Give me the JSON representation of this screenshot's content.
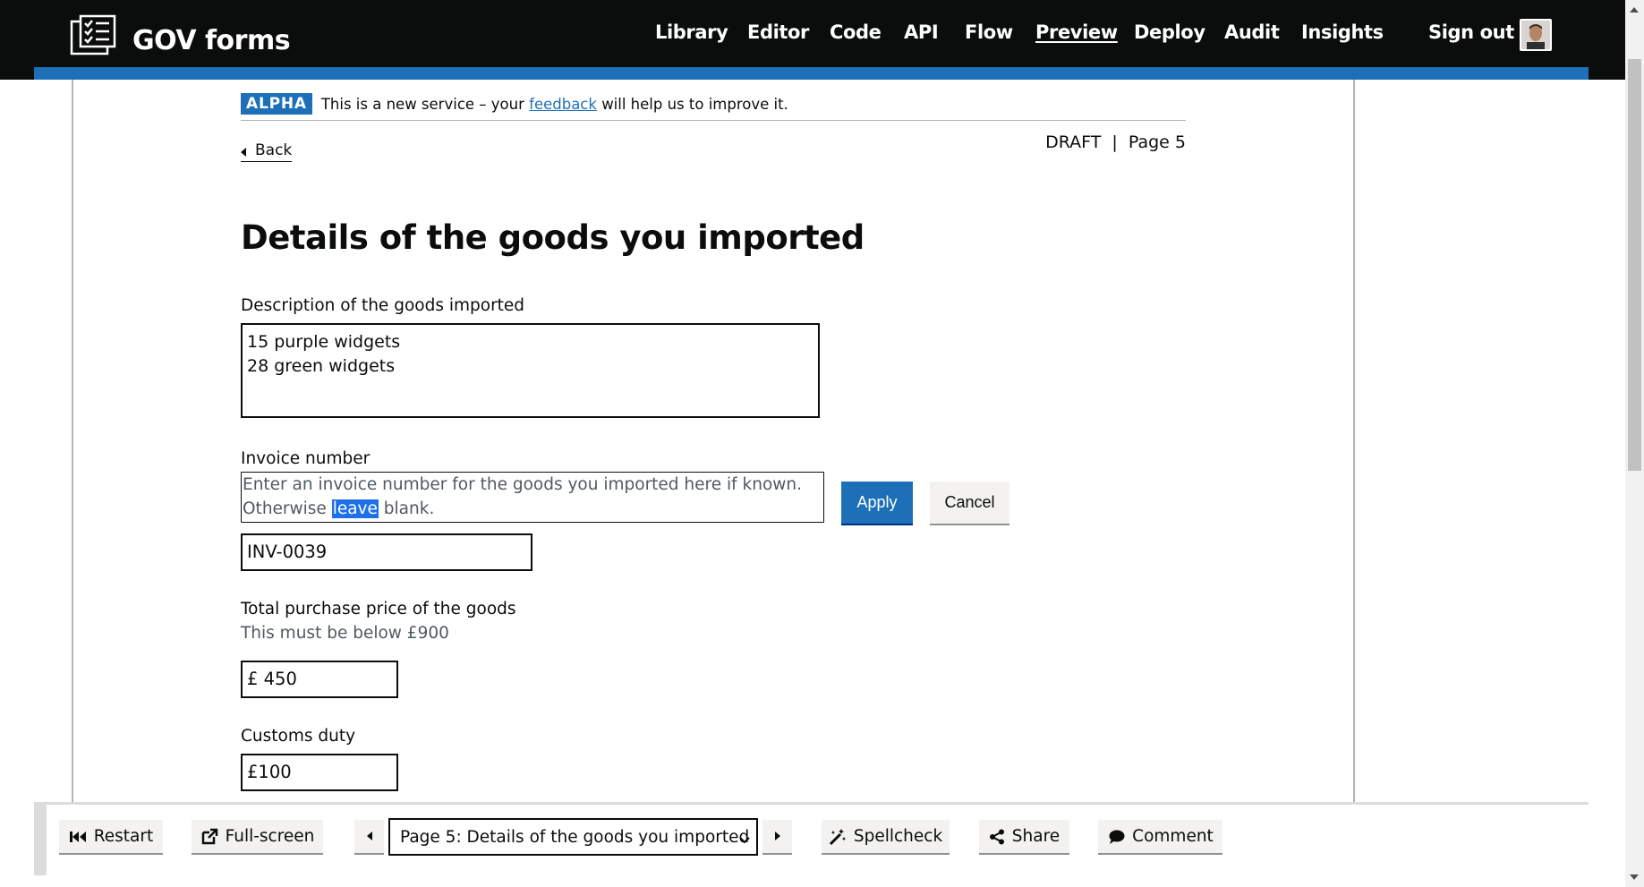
{
  "header": {
    "brand": "GOV forms",
    "nav": [
      {
        "label": "Library",
        "active": false
      },
      {
        "label": "Editor",
        "active": false
      },
      {
        "label": "Code",
        "active": false
      },
      {
        "label": "API",
        "active": false
      },
      {
        "label": "Flow",
        "active": false
      },
      {
        "label": "Preview",
        "active": true
      },
      {
        "label": "Deploy",
        "active": false
      },
      {
        "label": "Audit",
        "active": false
      },
      {
        "label": "Insights",
        "active": false
      },
      {
        "label": "Sign out",
        "active": false
      }
    ]
  },
  "phase_banner": {
    "tag": "ALPHA",
    "text_before": "This is a new service – your",
    "link": "feedback",
    "text_after": "will help us to improve it."
  },
  "page": {
    "back": "Back",
    "status": "DRAFT",
    "page_number": "Page 5",
    "title": "Details of the goods you imported"
  },
  "fields": {
    "description": {
      "label": "Description of the goods imported",
      "value": "15 purple widgets\n28 green widgets"
    },
    "invoice": {
      "label": "Invoice number",
      "hint_line1": "Enter an invoice number for the goods you imported here if known.",
      "hint_line2_before": "Otherwise ",
      "hint_highlight": "leave",
      "hint_line2_after": " blank.",
      "value": "INV-0039"
    },
    "price": {
      "label": "Total purchase price of the goods",
      "hint": "This must be below £900",
      "prefix": "£",
      "value": "450"
    },
    "duty": {
      "label": "Customs duty",
      "prefix": "£",
      "value": "100"
    }
  },
  "hint_editor": {
    "apply": "Apply",
    "cancel": "Cancel"
  },
  "toolbar": {
    "restart": "Restart",
    "fullscreen": "Full-screen",
    "page_select": "Page 5: Details of the goods you imported",
    "spellcheck": "Spellcheck",
    "share": "Share",
    "comment": "Comment"
  },
  "colors": {
    "header_bg": "#0b0c0c",
    "brand_blue": "#1d70b8",
    "button_grey": "#f3f2f1"
  }
}
